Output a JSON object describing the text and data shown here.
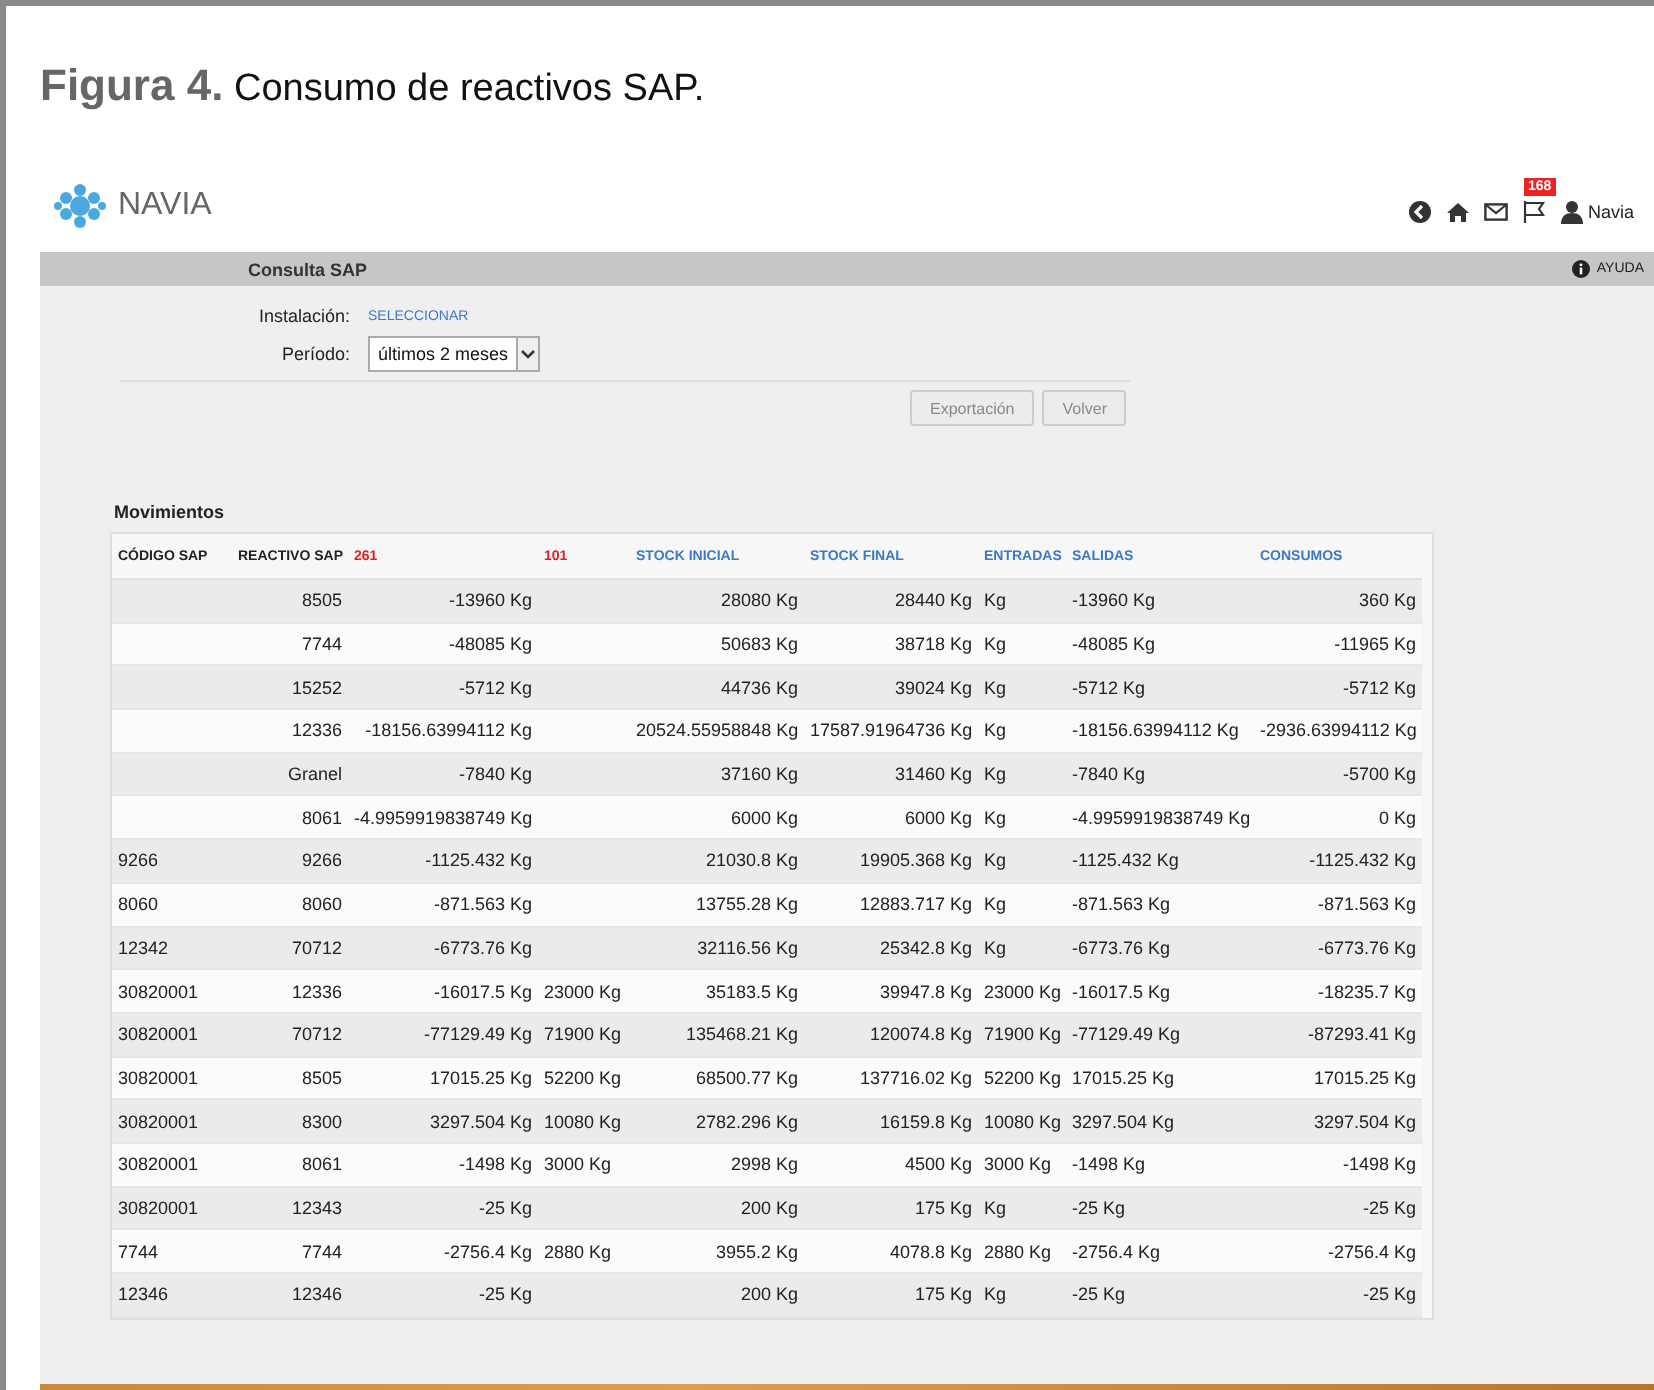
{
  "figure": {
    "caption": "**Figura 4.** Consumo de reactivos SAP."
  },
  "header": {
    "logo_text": "NAVIA",
    "notification_count": "168",
    "user": "Navia"
  },
  "title_bar": {
    "title": "Consulta SAP",
    "help": "AYUDA"
  },
  "form": {
    "installation_label": "Instalación:",
    "installation_link": "SELECCIONAR",
    "period_label": "Período:",
    "period_value": "últimos 2 meses"
  },
  "buttons": [
    "Exportación",
    "Volver"
  ],
  "section_title": "Movimientos",
  "table": {
    "columns": [
      {
        "label": "CÓDIGO SAP",
        "kind": "plain"
      },
      {
        "label": "REACTIVO SAP",
        "kind": "plain"
      },
      {
        "label": "261",
        "kind": "flag"
      },
      {
        "label": "101",
        "kind": "flag"
      },
      {
        "label": "STOCK INICIAL",
        "kind": "link"
      },
      {
        "label": "STOCK FINAL",
        "kind": "link"
      },
      {
        "label": "ENTRADAS",
        "kind": "link"
      },
      {
        "label": "SALIDAS",
        "kind": "link"
      },
      {
        "label": "CONSUMOS",
        "kind": "link"
      }
    ],
    "rows": [
      [
        null,
        "8505",
        "-13960 Kg",
        null,
        "28080 Kg",
        "28440 Kg",
        "Kg",
        "-13960 Kg",
        "360 Kg"
      ],
      [
        null,
        "7744",
        "-48085 Kg",
        null,
        "50683 Kg",
        "38718 Kg",
        "Kg",
        "-48085 Kg",
        "-11965 Kg"
      ],
      [
        null,
        "15252",
        "-5712 Kg",
        null,
        "44736 Kg",
        "39024 Kg",
        "Kg",
        "-5712 Kg",
        "-5712 Kg"
      ],
      [
        null,
        "12336",
        "-18156.63994112 Kg",
        null,
        "20524.55958848 Kg",
        "17587.91964736 Kg",
        "Kg",
        "-18156.63994112 Kg",
        "-2936.63994112 Kg"
      ],
      [
        null,
        "Granel",
        "-7840 Kg",
        null,
        "37160 Kg",
        "31460 Kg",
        "Kg",
        "-7840 Kg",
        "-5700 Kg"
      ],
      [
        null,
        "8061",
        "-4.9959919838749 Kg",
        null,
        "6000 Kg",
        "6000 Kg",
        "Kg",
        "-4.9959919838749 Kg",
        "0 Kg"
      ],
      [
        "9266",
        "9266",
        "-1125.432 Kg",
        null,
        "21030.8 Kg",
        "19905.368 Kg",
        "Kg",
        "-1125.432 Kg",
        "-1125.432 Kg"
      ],
      [
        "8060",
        "8060",
        "-871.563 Kg",
        null,
        "13755.28 Kg",
        "12883.717 Kg",
        "Kg",
        "-871.563 Kg",
        "-871.563 Kg"
      ],
      [
        "12342",
        "70712",
        "-6773.76 Kg",
        null,
        "32116.56 Kg",
        "25342.8 Kg",
        "Kg",
        "-6773.76 Kg",
        "-6773.76 Kg"
      ],
      [
        "30820001",
        "12336",
        "-16017.5 Kg",
        "23000 Kg",
        "35183.5 Kg",
        "39947.8 Kg",
        "23000 Kg",
        "-16017.5 Kg",
        "-18235.7 Kg"
      ],
      [
        "30820001",
        "70712",
        "-77129.49 Kg",
        "71900 Kg",
        "135468.21 Kg",
        "120074.8 Kg",
        "71900 Kg",
        "-77129.49 Kg",
        "-87293.41 Kg"
      ],
      [
        "30820001",
        "8505",
        "17015.25 Kg",
        "52200 Kg",
        "68500.77 Kg",
        "137716.02 Kg",
        "52200 Kg",
        "17015.25 Kg",
        "17015.25 Kg"
      ],
      [
        "30820001",
        "8300",
        "3297.504 Kg",
        "10080 Kg",
        "2782.296 Kg",
        "16159.8 Kg",
        "10080 Kg",
        "3297.504 Kg",
        "3297.504 Kg"
      ],
      [
        "30820001",
        "8061",
        "-1498 Kg",
        "3000 Kg",
        "2998 Kg",
        "4500 Kg",
        "3000 Kg",
        "-1498 Kg",
        "-1498 Kg"
      ],
      [
        "30820001",
        "12343",
        "-25 Kg",
        null,
        "200 Kg",
        "175 Kg",
        "Kg",
        "-25 Kg",
        "-25 Kg"
      ],
      [
        "7744",
        "7744",
        "-2756.4 Kg",
        "2880 Kg",
        "3955.2 Kg",
        "4078.8 Kg",
        "2880 Kg",
        "-2756.4 Kg",
        "-2756.4 Kg"
      ],
      [
        "12346",
        "12346",
        "-25 Kg",
        null,
        "200 Kg",
        "175 Kg",
        "Kg",
        "-25 Kg",
        "-25 Kg"
      ]
    ]
  }
}
